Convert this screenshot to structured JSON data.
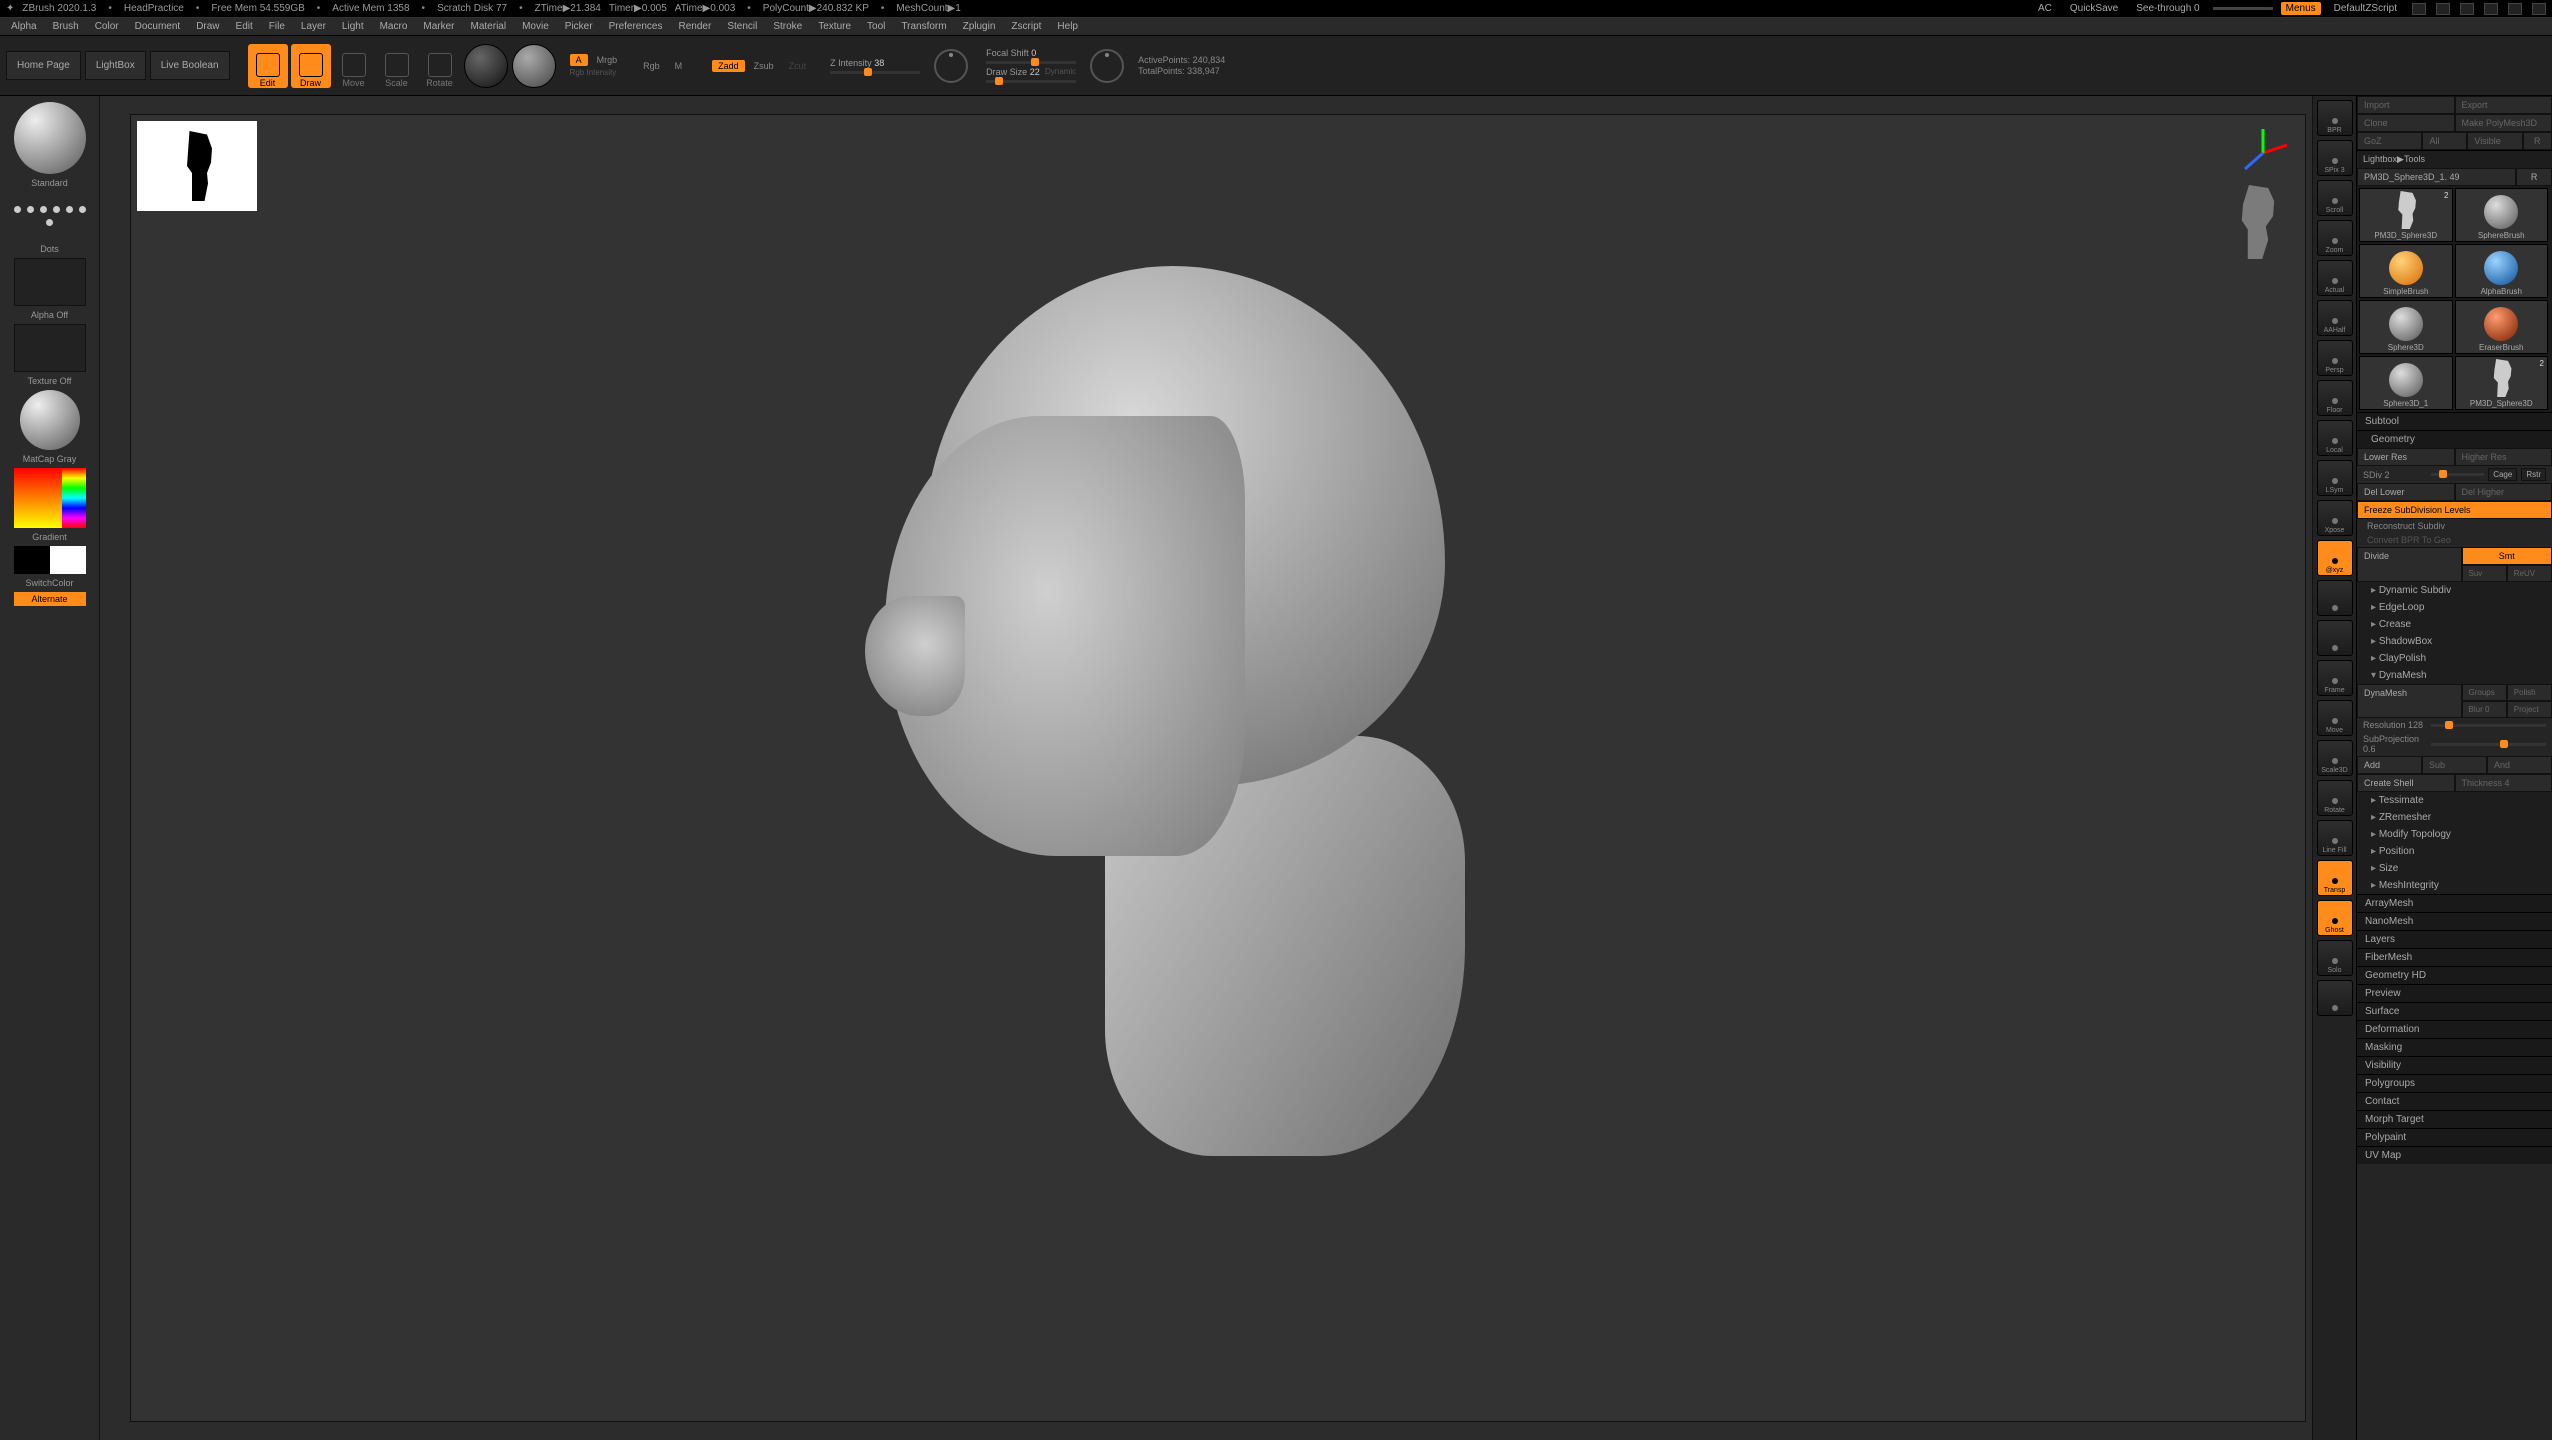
{
  "title": {
    "app": "ZBrush 2020.1.3",
    "doc": "HeadPractice",
    "mem": "Free Mem 54.559GB",
    "active_mem": "Active Mem 1358",
    "scratch": "Scratch Disk 77",
    "ztime": "ZTime▶21.384",
    "timer": "Timer▶0.005",
    "atime": "ATime▶0.003",
    "poly": "PolyCount▶240.832 KP",
    "mesh": "MeshCount▶1",
    "ac": "AC",
    "quicksave": "QuickSave",
    "seethrough": "See-through  0",
    "menus": "Menus",
    "defscript": "DefaultZScript"
  },
  "menu": [
    "Alpha",
    "Brush",
    "Color",
    "Document",
    "Draw",
    "Edit",
    "File",
    "Layer",
    "Light",
    "Macro",
    "Marker",
    "Material",
    "Movie",
    "Picker",
    "Preferences",
    "Render",
    "Stencil",
    "Stroke",
    "Texture",
    "Tool",
    "Transform",
    "Zplugin",
    "Zscript",
    "Help"
  ],
  "shelf": {
    "tabs": [
      "Home Page",
      "LightBox",
      "Live Boolean"
    ],
    "tools": [
      {
        "label": "Edit",
        "on": true
      },
      {
        "label": "Draw",
        "on": true
      },
      {
        "label": "Move",
        "on": false
      },
      {
        "label": "Scale",
        "on": false
      },
      {
        "label": "Rotate",
        "on": false
      }
    ],
    "mrgb_group": {
      "a": "A",
      "mrgb": "Mrgb",
      "rgb": "Rgb",
      "m": "M",
      "sub": "Rgb Intensity"
    },
    "zadd_group": {
      "zadd": "Zadd",
      "zsub": "Zsub",
      "zcut": "Zcut"
    },
    "z_intensity": {
      "label": "Z Intensity",
      "value": "38"
    },
    "focal": {
      "label": "Focal Shift",
      "value": "0"
    },
    "draw_size": {
      "label": "Draw Size",
      "value": "22",
      "dyn": "Dynamic"
    },
    "stats": {
      "active": "ActivePoints: 240,834",
      "total": "TotalPoints: 338,947"
    }
  },
  "left": {
    "brush": "Standard",
    "stroke": "Dots",
    "alpha": "Alpha Off",
    "texture": "Texture Off",
    "material": "MatCap Gray",
    "gradient": "Gradient",
    "switch": "SwitchColor",
    "alt": "Alternate"
  },
  "vstrip": [
    {
      "label": "BPR",
      "on": false
    },
    {
      "label": "SPix 3",
      "on": false
    },
    {
      "label": "Scroll",
      "on": false
    },
    {
      "label": "Zoom",
      "on": false
    },
    {
      "label": "Actual",
      "on": false
    },
    {
      "label": "AAHalf",
      "on": false
    },
    {
      "label": "Persp",
      "on": false
    },
    {
      "label": "Floor",
      "on": false
    },
    {
      "label": "Local",
      "on": false
    },
    {
      "label": "LSym",
      "on": false
    },
    {
      "label": "Xpose",
      "on": false
    },
    {
      "label": "@xyz",
      "on": true
    },
    {
      "label": "",
      "on": false
    },
    {
      "label": "",
      "on": false
    },
    {
      "label": "Frame",
      "on": false
    },
    {
      "label": "Move",
      "on": false
    },
    {
      "label": "Scale3D",
      "on": false
    },
    {
      "label": "Rotate",
      "on": false
    },
    {
      "label": "Line Fill",
      "on": false
    },
    {
      "label": "Transp",
      "on": true
    },
    {
      "label": "Ghost",
      "on": true
    },
    {
      "label": "Solo",
      "on": false
    },
    {
      "label": "",
      "on": false
    }
  ],
  "right": {
    "top": {
      "import": "Import",
      "export": "Export",
      "clone": "Clone",
      "makepoly": "Make PolyMesh3D",
      "goz": "GoZ",
      "all": "All",
      "visible": "Visible",
      "r": "R"
    },
    "nav": "Lightbox▶Tools",
    "tool_name": "PM3D_Sphere3D_1. 49",
    "thumbs": [
      {
        "label": "PM3D_Sphere3D",
        "kind": "hd",
        "badge": "2"
      },
      {
        "label": "SphereBrush",
        "kind": "ball"
      },
      {
        "label": "SimpleBrush",
        "kind": "org"
      },
      {
        "label": "AlphaBrush",
        "kind": "blu"
      },
      {
        "label": "Sphere3D",
        "kind": "ball"
      },
      {
        "label": "EraserBrush",
        "kind": "red"
      },
      {
        "label": "Sphere3D_1",
        "kind": "ball"
      },
      {
        "label": "PM3D_Sphere3D",
        "kind": "hd",
        "badge": "2"
      }
    ],
    "subtool": "Subtool",
    "geometry": "Geometry",
    "geo": {
      "lower": "Lower Res",
      "higher": "Higher Res",
      "sdiv_label": "SDiv",
      "sdiv": "2",
      "cage": "Cage",
      "rstr": "Rstr",
      "del_lower": "Del Lower",
      "del_higher": "Del Higher",
      "freeze": "Freeze SubDivision Levels",
      "reconstruct": "Reconstruct Subdiv",
      "convert": "Convert BPR To Geo",
      "divide": "Divide",
      "smt": "Smt",
      "suv": "Suv",
      "reuv": "ReUV",
      "dynsub": "Dynamic Subdiv",
      "edgeloop": "EdgeLoop",
      "crease": "Crease",
      "shadowbox": "ShadowBox",
      "claypolish": "ClayPolish",
      "dynamesh": "DynaMesh",
      "dm_btn": "DynaMesh",
      "groups": "Groups",
      "polish": "Polish",
      "blur_label": "Blur",
      "blur": "0",
      "project": "Project",
      "res_label": "Resolution",
      "res": "128",
      "subproj_label": "SubProjection",
      "subproj": "0.6",
      "add": "Add",
      "sub": "Sub",
      "and": "And",
      "shell": "Create Shell",
      "thick_label": "Thickness",
      "thick": "4",
      "tess": "Tessimate",
      "zrem": "ZRemesher",
      "modtop": "Modify Topology",
      "pos": "Position",
      "size": "Size",
      "meshint": "MeshIntegrity"
    },
    "sections": [
      "ArrayMesh",
      "NanoMesh",
      "Layers",
      "FiberMesh",
      "Geometry HD",
      "Preview",
      "Surface",
      "Deformation",
      "Masking",
      "Visibility",
      "Polygroups",
      "Contact",
      "Morph Target",
      "Polypaint",
      "UV Map"
    ]
  }
}
